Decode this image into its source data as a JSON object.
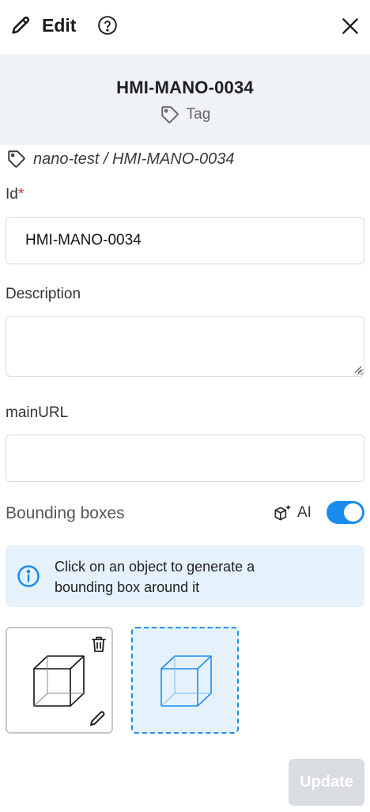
{
  "header": {
    "title": "Edit",
    "icons": [
      "pencil-icon",
      "help-circle-icon",
      "close-icon"
    ]
  },
  "banner": {
    "name": "HMI-MANO-0034",
    "type_label": "Tag",
    "type_icon": "tag-icon"
  },
  "path": {
    "text": "nano-test / HMI-MANO-0034",
    "icon": "tag-icon"
  },
  "form": {
    "id_label": "Id",
    "id_required_mark": "*",
    "id_value": "HMI-MANO-0034",
    "description_label": "Description",
    "description_value": "",
    "mainurl_label": "mainURL",
    "mainurl_value": ""
  },
  "bounding_boxes": {
    "label": "Bounding boxes",
    "ai_label": "AI",
    "ai_icon": "ai-cube-icon",
    "ai_enabled": true,
    "info_text": "Click on an object to generate a bounding box around it",
    "items": [
      {
        "style": "solid",
        "selected": false,
        "icons": [
          "trash-icon",
          "pencil-icon"
        ]
      },
      {
        "style": "dashed",
        "selected": true
      }
    ]
  },
  "footer": {
    "update_label": "Update",
    "update_disabled": true
  },
  "colors": {
    "accent": "#1a8cf0",
    "banner_bg": "#eff2f6",
    "info_bg": "#e5f2fc",
    "required": "#e03131",
    "disabled_button": "#d9dde2"
  }
}
